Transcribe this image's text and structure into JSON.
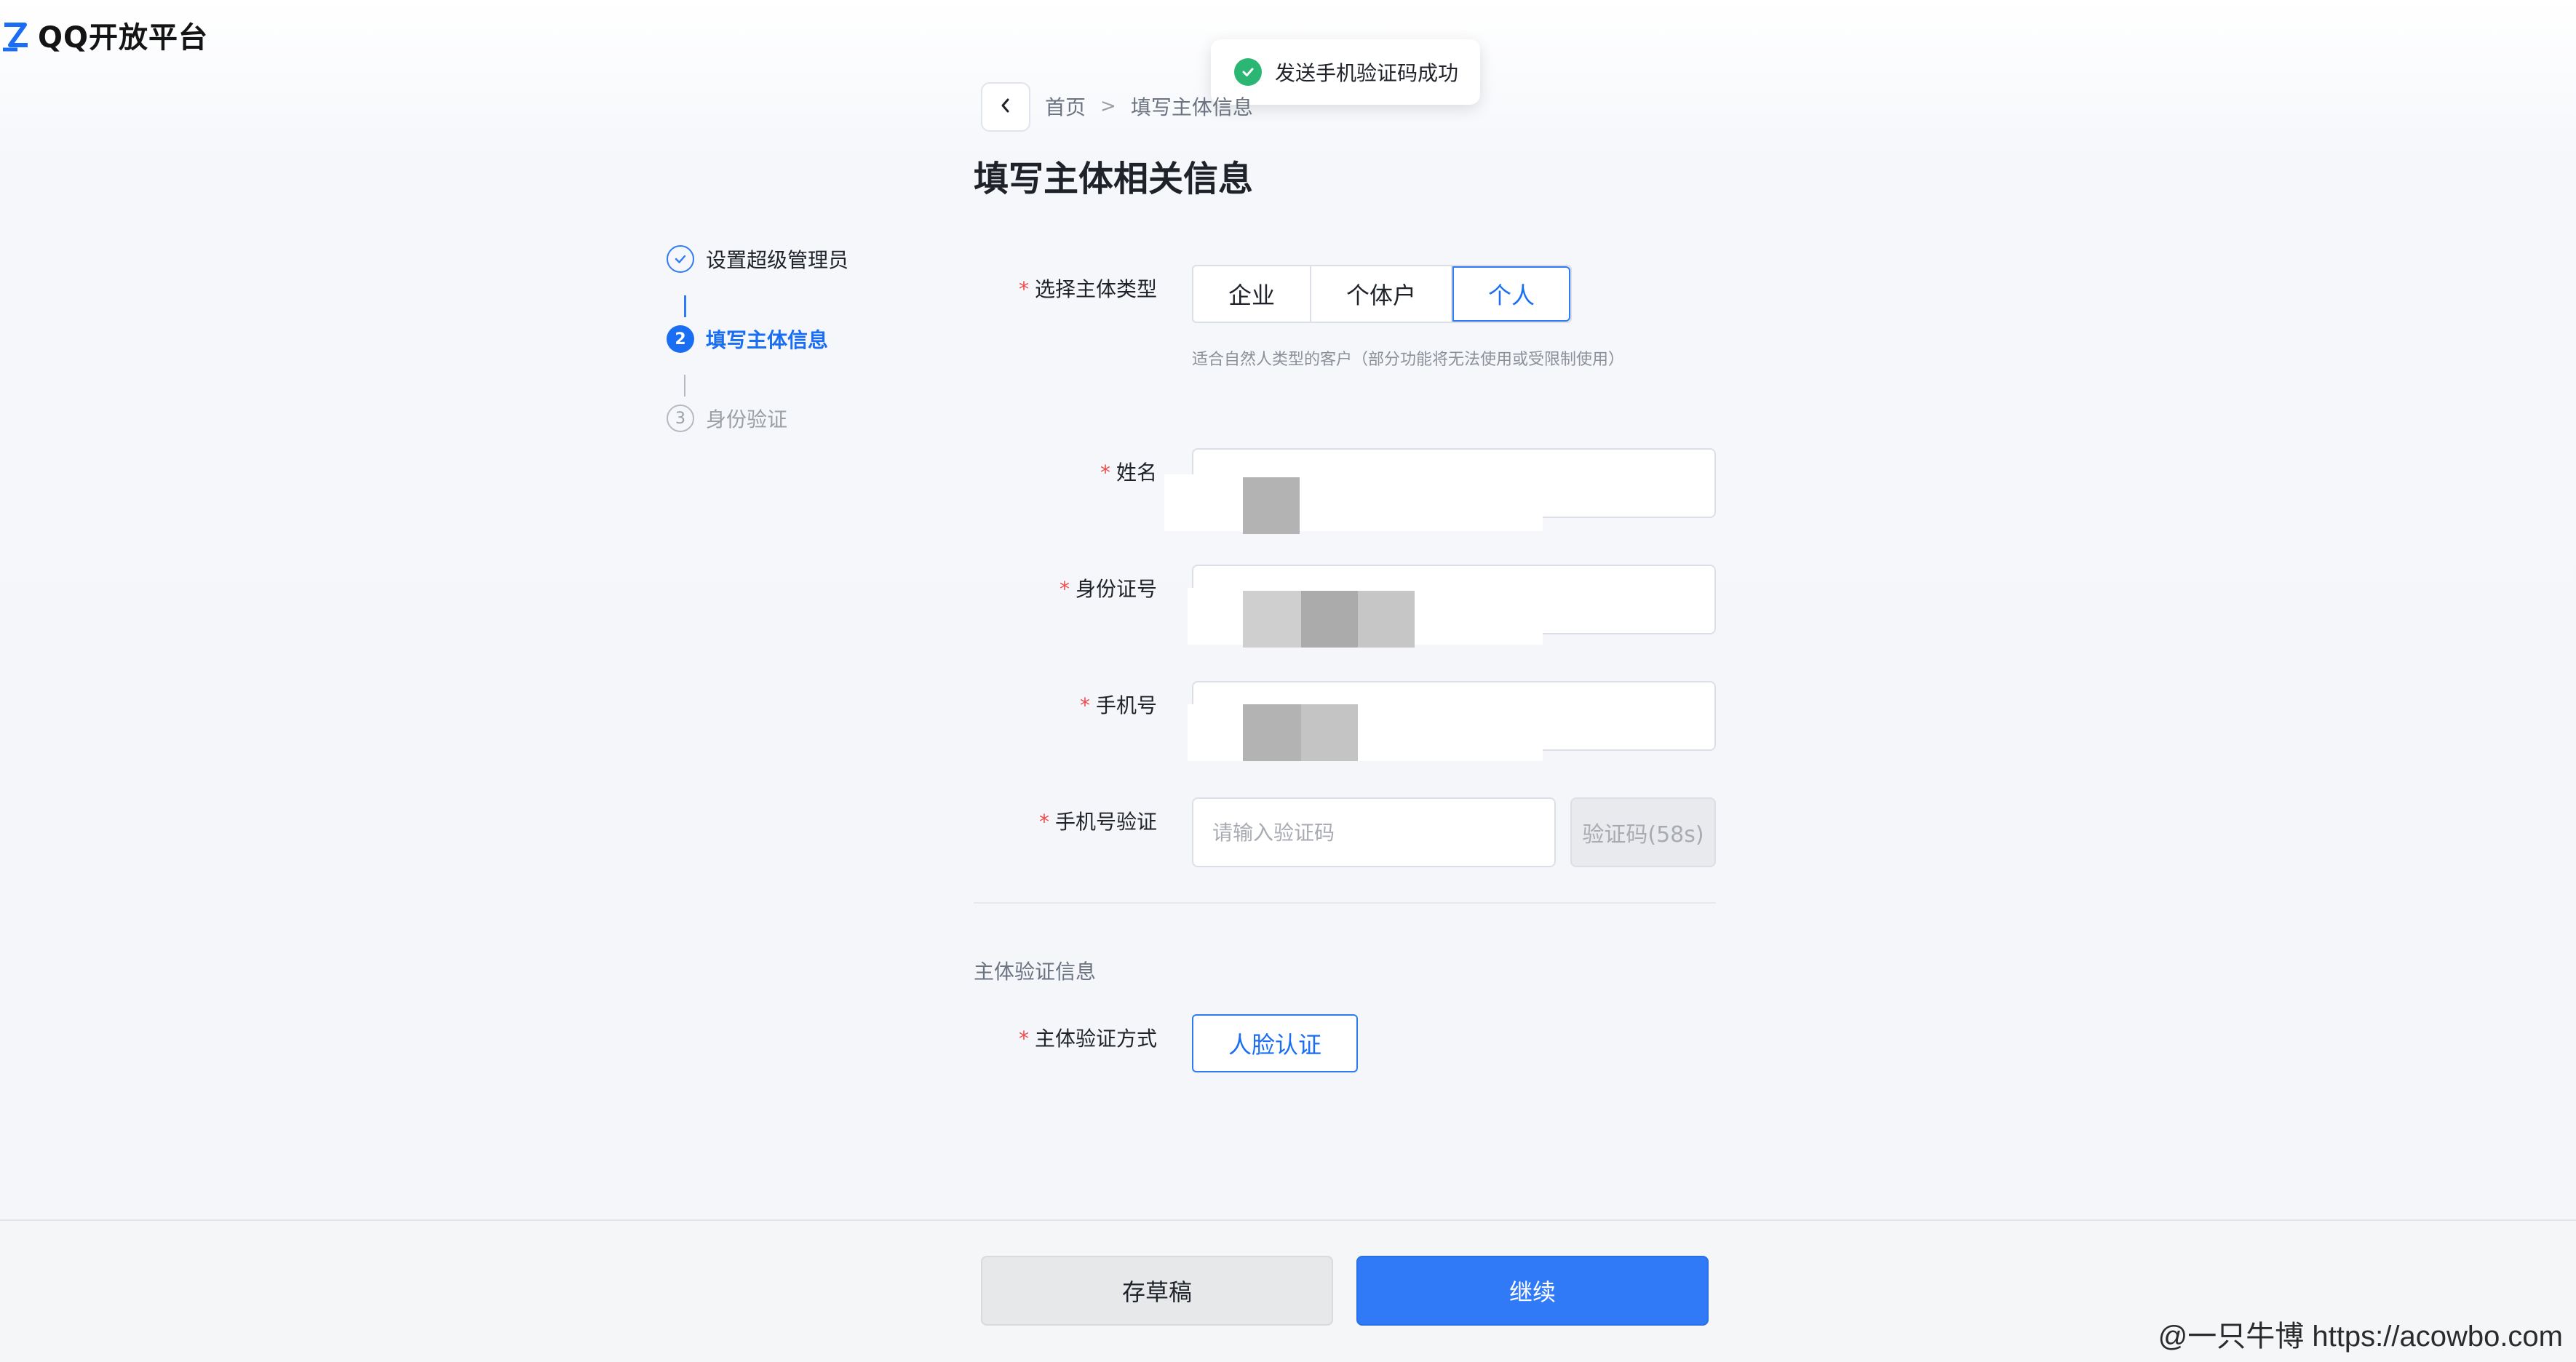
{
  "app": {
    "logo_text": "QQ开放平台"
  },
  "toast": {
    "message": "发送手机验证码成功",
    "status_color": "#2bb673"
  },
  "breadcrumb": {
    "home": "首页",
    "current": "填写主体信息",
    "separator": ">"
  },
  "page_title": "填写主体相关信息",
  "steps": [
    {
      "index": "✓",
      "label": "设置超级管理员",
      "state": "done"
    },
    {
      "index": "2",
      "label": "填写主体信息",
      "state": "active"
    },
    {
      "index": "3",
      "label": "身份验证",
      "state": "pending"
    }
  ],
  "form": {
    "required_mark": "*",
    "entity_type": {
      "label": "选择主体类型",
      "options": [
        "企业",
        "个体户",
        "个人"
      ],
      "selected": "个人",
      "hint": "适合自然人类型的客户（部分功能将无法使用或受限制使用）"
    },
    "name": {
      "label": "姓名"
    },
    "id_number": {
      "label": "身份证号"
    },
    "phone": {
      "label": "手机号"
    },
    "phone_verify": {
      "label": "手机号验证",
      "placeholder": "请输入验证码",
      "code_button": "验证码(58s)"
    },
    "section_title": "主体验证信息",
    "verify_method": {
      "label": "主体验证方式",
      "option": "人脸认证"
    }
  },
  "footer": {
    "draft_label": "存草稿",
    "continue_label": "继续"
  },
  "watermark": "@一只牛博 https://acowbo.com",
  "colors": {
    "accent": "#1a6ef3",
    "primary_button": "#3079f7",
    "required": "#f04b4b"
  }
}
